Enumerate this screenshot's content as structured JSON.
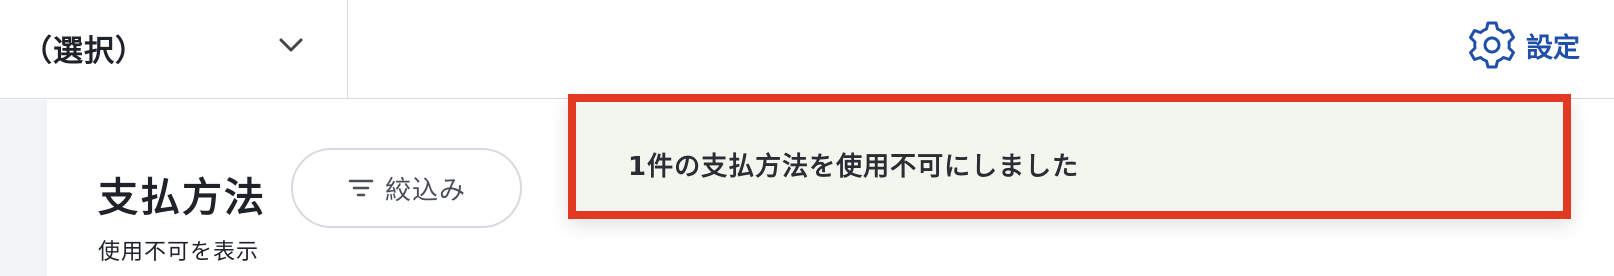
{
  "header": {
    "selector_label": "（選択）",
    "settings_label": "設定"
  },
  "page": {
    "title": "支払方法",
    "filter_label": "絞込み",
    "show_disabled_label": "使用不可を表示"
  },
  "toast": {
    "message": "1件の支払方法を使用不可にしました"
  },
  "colors": {
    "accent": "#1f4fa8",
    "toast_border": "#e23a22",
    "toast_background": "#f3f6ef"
  },
  "icons": {
    "selector": "chevron-down-icon",
    "settings": "gear-icon",
    "filter": "filter-icon"
  }
}
